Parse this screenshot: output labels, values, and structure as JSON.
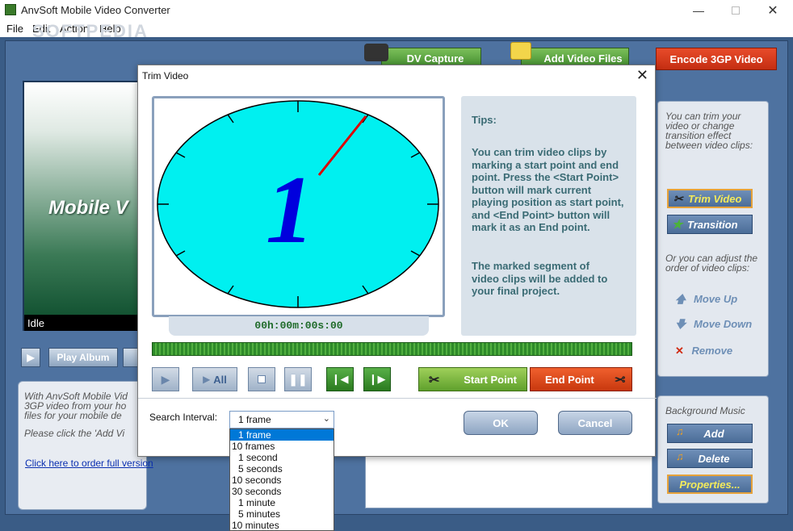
{
  "window": {
    "title": "AnvSoft Mobile Video Converter",
    "minimize_icon": "minimize-icon",
    "maximize_icon": "maximize-icon",
    "close_icon": "close-icon"
  },
  "menu": [
    "File",
    "Edit",
    "Action",
    "Help"
  ],
  "toolbar": {
    "dv_capture": "DV Capture",
    "add_video_files": "Add Video Files",
    "encode": "Encode 3GP Video"
  },
  "preview": {
    "title": "Mobile V",
    "status": "Idle",
    "play_album": "Play Album"
  },
  "info": {
    "line1": "With AnvSoft Mobile Vid",
    "line2": "3GP video from your ho",
    "line3": "files for your mobile de",
    "line4": "Please click the 'Add Vi",
    "order_link": "Click here to order full version"
  },
  "right_panel": {
    "intro": "You can trim your video or change transition effect between video clips:",
    "trim_video": "Trim Video",
    "transition": "Transition",
    "order_text": "Or you can adjust the order of video clips:",
    "move_up": "Move Up",
    "move_down": "Move Down",
    "remove": "Remove"
  },
  "music_panel": {
    "title": "Background Music",
    "add": "Add",
    "delete": "Delete",
    "properties": "Properties..."
  },
  "dialog": {
    "title": "Trim Video",
    "timecode": "00h:00m:00s:00",
    "tips_title": "Tips:",
    "tips_body": "You can trim video clips by marking a start point and end point. Press the <Start Point> button will mark current playing position as start point, and <End Point> button will mark it as an End point.",
    "tips_body2": "The marked segment of video clips will be added to your final project.",
    "all_label": "All",
    "start_point": "Start Point",
    "end_point": "End Point",
    "search_label": "Search Interval:",
    "search_value": "1 frame",
    "ok": "OK",
    "cancel": "Cancel",
    "clock_digit": "1"
  },
  "interval_options": [
    "1 frame",
    "10 frames",
    "1 second",
    "5 seconds",
    "10 seconds",
    "30 seconds",
    "1 minute",
    "5 minutes",
    "10 minutes"
  ],
  "colors": {
    "accent_green": "#3f8a2c",
    "accent_red": "#c42e12",
    "clock_face": "#00f0f0",
    "clock_hand": "#0000dd",
    "app_blue": "#3a5c86"
  },
  "watermark": "SOFTPEDIA"
}
